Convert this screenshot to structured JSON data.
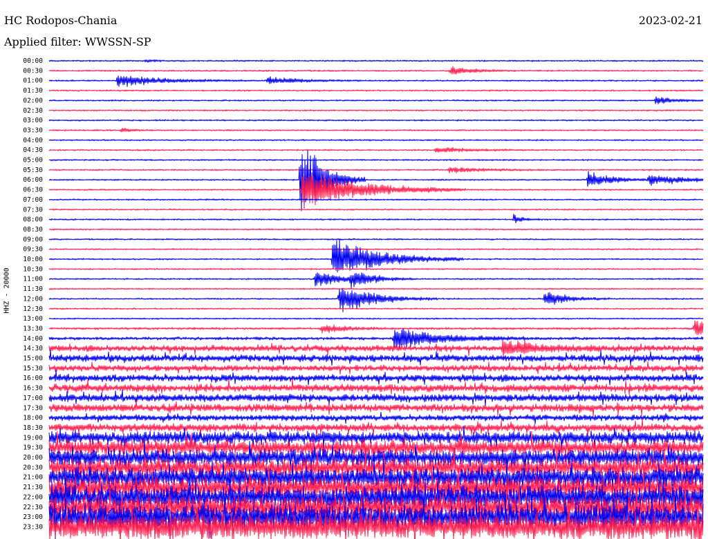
{
  "header": {
    "station": "HC Rodopos-Chania",
    "date": "2023-02-21",
    "filter": "Applied filter: WWSSN-SP"
  },
  "channel_label": "HHZ - 20000",
  "colors": {
    "trace_a": "#0000ee",
    "trace_b": "#ff1f4f",
    "background": "#ffffff",
    "text": "#000000"
  },
  "chart_data": {
    "type": "line",
    "subtype": "helicorder",
    "row_labels": [
      "00:00",
      "00:30",
      "01:00",
      "01:30",
      "02:00",
      "02:30",
      "03:00",
      "03:30",
      "04:00",
      "04:30",
      "05:00",
      "05:30",
      "06:00",
      "06:30",
      "07:00",
      "07:30",
      "08:00",
      "08:30",
      "09:00",
      "09:30",
      "10:00",
      "10:30",
      "11:00",
      "11:30",
      "12:00",
      "12:30",
      "13:00",
      "13:30",
      "14:00",
      "14:30",
      "15:00",
      "15:30",
      "16:00",
      "16:30",
      "17:00",
      "17:30",
      "18:00",
      "18:30",
      "19:00",
      "19:30",
      "20:00",
      "20:30",
      "21:00",
      "21:30",
      "22:00",
      "22:30",
      "23:00",
      "23:30"
    ],
    "row_minutes": 30,
    "row_colors": [
      "trace_a",
      "trace_b"
    ],
    "noise_levels": [
      1,
      1,
      1,
      1,
      1,
      1,
      1,
      1,
      1,
      1,
      1,
      1,
      1,
      1,
      1,
      1,
      1,
      1,
      1,
      1,
      1,
      1,
      1,
      1,
      1,
      1,
      1,
      1.5,
      2,
      4,
      4.5,
      4,
      4.5,
      5,
      5,
      5,
      4,
      5,
      8,
      10,
      11,
      12,
      13,
      14,
      15,
      16,
      17,
      18
    ],
    "events": [
      {
        "row": 0,
        "minute": 4.4,
        "amplitude": 2,
        "duration": 0.5
      },
      {
        "row": 1,
        "minute": 18.4,
        "amplitude": 8,
        "duration": 1
      },
      {
        "row": 2,
        "minute": 3.1,
        "amplitude": 10,
        "duration": 2
      },
      {
        "row": 2,
        "minute": 10.0,
        "amplitude": 6,
        "duration": 1.5
      },
      {
        "row": 4,
        "minute": 27.8,
        "amplitude": 6,
        "duration": 1
      },
      {
        "row": 7,
        "minute": 3.3,
        "amplitude": 4,
        "duration": 0.5
      },
      {
        "row": 9,
        "minute": 17.7,
        "amplitude": 5,
        "duration": 1.5
      },
      {
        "row": 11,
        "minute": 18.3,
        "amplitude": 5,
        "duration": 1.5
      },
      {
        "row": 12,
        "minute": 11.5,
        "amplitude": 70,
        "duration": 1
      },
      {
        "row": 12,
        "minute": 24.7,
        "amplitude": 15,
        "duration": 1
      },
      {
        "row": 12,
        "minute": 27.5,
        "amplitude": 10,
        "duration": 1.5
      },
      {
        "row": 13,
        "minute": 11.6,
        "amplitude": 35,
        "duration": 2.5
      },
      {
        "row": 16,
        "minute": 21.3,
        "amplitude": 8,
        "duration": 0.4
      },
      {
        "row": 20,
        "minute": 13.0,
        "amplitude": 35,
        "duration": 2
      },
      {
        "row": 22,
        "minute": 12.2,
        "amplitude": 15,
        "duration": 1
      },
      {
        "row": 22,
        "minute": 13.8,
        "amplitude": 15,
        "duration": 1
      },
      {
        "row": 24,
        "minute": 13.3,
        "amplitude": 25,
        "duration": 1.5
      },
      {
        "row": 24,
        "minute": 22.7,
        "amplitude": 14,
        "duration": 1
      },
      {
        "row": 27,
        "minute": 12.5,
        "amplitude": 8,
        "duration": 1
      },
      {
        "row": 27,
        "minute": 29.6,
        "amplitude": 18,
        "duration": 1.2
      },
      {
        "row": 28,
        "minute": 15.8,
        "amplitude": 18,
        "duration": 2
      },
      {
        "row": 29,
        "minute": 20.8,
        "amplitude": 12,
        "duration": 1.5
      }
    ]
  }
}
